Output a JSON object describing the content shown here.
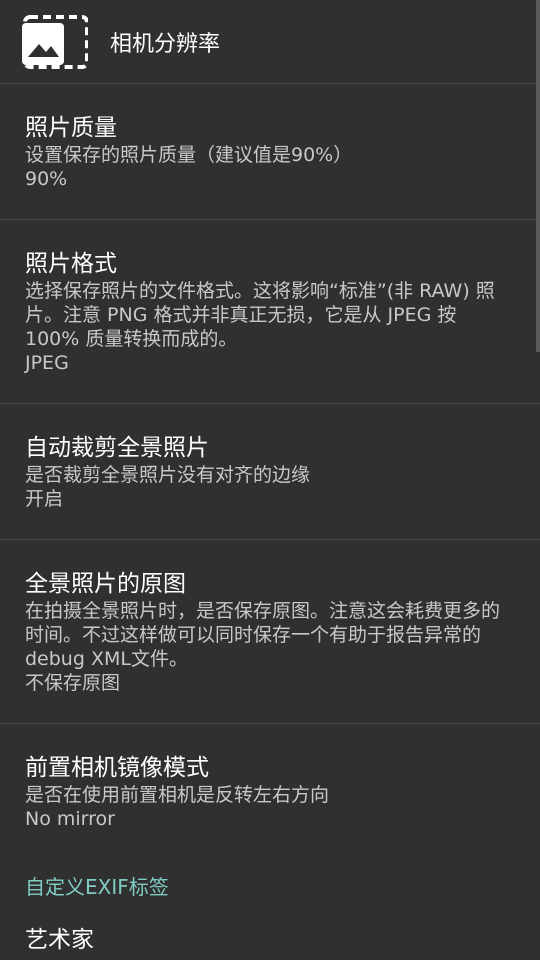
{
  "header": {
    "title": "相机分辨率",
    "icon": "image-icon"
  },
  "preferences": [
    {
      "title": "照片质量",
      "summary": "设置保存的照片质量（建议值是90%）",
      "value": "90%"
    },
    {
      "title": "照片格式",
      "summary": "选择保存照片的文件格式。这将影响“标准”(非 RAW) 照片。注意 PNG 格式并非真正无损，它是从 JPEG 按 100% 质量转换而成的。",
      "value": "JPEG"
    },
    {
      "title": "自动裁剪全景照片",
      "summary": "是否裁剪全景照片没有对齐的边缘",
      "value": "开启"
    },
    {
      "title": "全景照片的原图",
      "summary": "在拍摄全景照片时，是否保存原图。注意这会耗费更多的时间。不过这样做可以同时保存一个有助于报告异常的debug XML文件。",
      "value": "不保存原图"
    },
    {
      "title": "前置相机镜像模式",
      "summary": "是否在使用前置相机是反转左右方向",
      "value": "No mirror"
    }
  ],
  "category": {
    "label": "自定义EXIF标签",
    "first_item": "艺术家"
  },
  "colors": {
    "background": "#303030",
    "accent": "#80cbc4",
    "divider": "#474747"
  }
}
